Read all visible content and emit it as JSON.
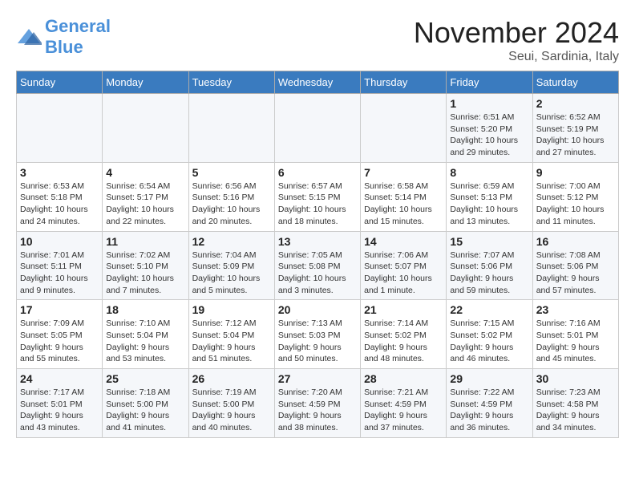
{
  "header": {
    "logo_text_general": "General",
    "logo_text_blue": "Blue",
    "month_title": "November 2024",
    "location": "Seui, Sardinia, Italy"
  },
  "weekdays": [
    "Sunday",
    "Monday",
    "Tuesday",
    "Wednesday",
    "Thursday",
    "Friday",
    "Saturday"
  ],
  "weeks": [
    [
      {
        "day": "",
        "info": ""
      },
      {
        "day": "",
        "info": ""
      },
      {
        "day": "",
        "info": ""
      },
      {
        "day": "",
        "info": ""
      },
      {
        "day": "",
        "info": ""
      },
      {
        "day": "1",
        "info": "Sunrise: 6:51 AM\nSunset: 5:20 PM\nDaylight: 10 hours and 29 minutes."
      },
      {
        "day": "2",
        "info": "Sunrise: 6:52 AM\nSunset: 5:19 PM\nDaylight: 10 hours and 27 minutes."
      }
    ],
    [
      {
        "day": "3",
        "info": "Sunrise: 6:53 AM\nSunset: 5:18 PM\nDaylight: 10 hours and 24 minutes."
      },
      {
        "day": "4",
        "info": "Sunrise: 6:54 AM\nSunset: 5:17 PM\nDaylight: 10 hours and 22 minutes."
      },
      {
        "day": "5",
        "info": "Sunrise: 6:56 AM\nSunset: 5:16 PM\nDaylight: 10 hours and 20 minutes."
      },
      {
        "day": "6",
        "info": "Sunrise: 6:57 AM\nSunset: 5:15 PM\nDaylight: 10 hours and 18 minutes."
      },
      {
        "day": "7",
        "info": "Sunrise: 6:58 AM\nSunset: 5:14 PM\nDaylight: 10 hours and 15 minutes."
      },
      {
        "day": "8",
        "info": "Sunrise: 6:59 AM\nSunset: 5:13 PM\nDaylight: 10 hours and 13 minutes."
      },
      {
        "day": "9",
        "info": "Sunrise: 7:00 AM\nSunset: 5:12 PM\nDaylight: 10 hours and 11 minutes."
      }
    ],
    [
      {
        "day": "10",
        "info": "Sunrise: 7:01 AM\nSunset: 5:11 PM\nDaylight: 10 hours and 9 minutes."
      },
      {
        "day": "11",
        "info": "Sunrise: 7:02 AM\nSunset: 5:10 PM\nDaylight: 10 hours and 7 minutes."
      },
      {
        "day": "12",
        "info": "Sunrise: 7:04 AM\nSunset: 5:09 PM\nDaylight: 10 hours and 5 minutes."
      },
      {
        "day": "13",
        "info": "Sunrise: 7:05 AM\nSunset: 5:08 PM\nDaylight: 10 hours and 3 minutes."
      },
      {
        "day": "14",
        "info": "Sunrise: 7:06 AM\nSunset: 5:07 PM\nDaylight: 10 hours and 1 minute."
      },
      {
        "day": "15",
        "info": "Sunrise: 7:07 AM\nSunset: 5:06 PM\nDaylight: 9 hours and 59 minutes."
      },
      {
        "day": "16",
        "info": "Sunrise: 7:08 AM\nSunset: 5:06 PM\nDaylight: 9 hours and 57 minutes."
      }
    ],
    [
      {
        "day": "17",
        "info": "Sunrise: 7:09 AM\nSunset: 5:05 PM\nDaylight: 9 hours and 55 minutes."
      },
      {
        "day": "18",
        "info": "Sunrise: 7:10 AM\nSunset: 5:04 PM\nDaylight: 9 hours and 53 minutes."
      },
      {
        "day": "19",
        "info": "Sunrise: 7:12 AM\nSunset: 5:04 PM\nDaylight: 9 hours and 51 minutes."
      },
      {
        "day": "20",
        "info": "Sunrise: 7:13 AM\nSunset: 5:03 PM\nDaylight: 9 hours and 50 minutes."
      },
      {
        "day": "21",
        "info": "Sunrise: 7:14 AM\nSunset: 5:02 PM\nDaylight: 9 hours and 48 minutes."
      },
      {
        "day": "22",
        "info": "Sunrise: 7:15 AM\nSunset: 5:02 PM\nDaylight: 9 hours and 46 minutes."
      },
      {
        "day": "23",
        "info": "Sunrise: 7:16 AM\nSunset: 5:01 PM\nDaylight: 9 hours and 45 minutes."
      }
    ],
    [
      {
        "day": "24",
        "info": "Sunrise: 7:17 AM\nSunset: 5:01 PM\nDaylight: 9 hours and 43 minutes."
      },
      {
        "day": "25",
        "info": "Sunrise: 7:18 AM\nSunset: 5:00 PM\nDaylight: 9 hours and 41 minutes."
      },
      {
        "day": "26",
        "info": "Sunrise: 7:19 AM\nSunset: 5:00 PM\nDaylight: 9 hours and 40 minutes."
      },
      {
        "day": "27",
        "info": "Sunrise: 7:20 AM\nSunset: 4:59 PM\nDaylight: 9 hours and 38 minutes."
      },
      {
        "day": "28",
        "info": "Sunrise: 7:21 AM\nSunset: 4:59 PM\nDaylight: 9 hours and 37 minutes."
      },
      {
        "day": "29",
        "info": "Sunrise: 7:22 AM\nSunset: 4:59 PM\nDaylight: 9 hours and 36 minutes."
      },
      {
        "day": "30",
        "info": "Sunrise: 7:23 AM\nSunset: 4:58 PM\nDaylight: 9 hours and 34 minutes."
      }
    ]
  ]
}
